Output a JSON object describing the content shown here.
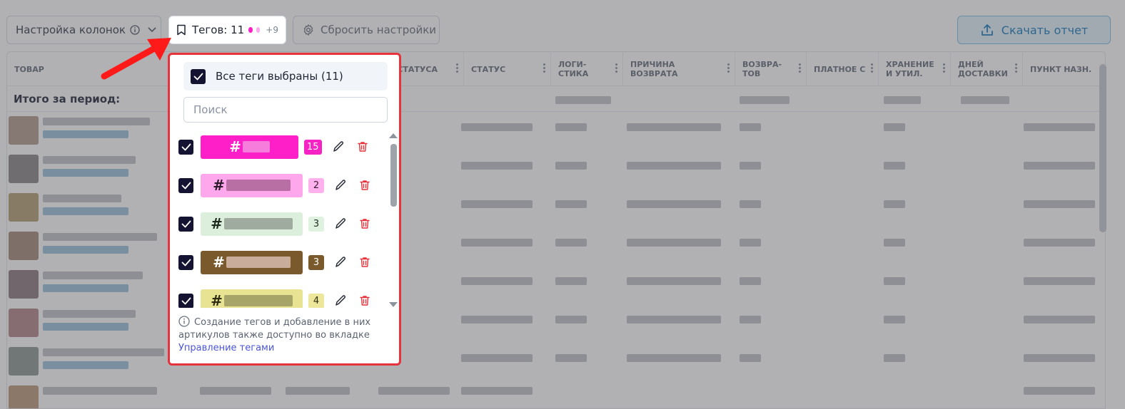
{
  "toolbar": {
    "columns_label": "Настройка колонок",
    "tags_label": "Тегов: 11",
    "tags_more": "+9",
    "reset_label": "Сбросить настройки",
    "download_label": "Скачать отчет"
  },
  "table": {
    "headers": [
      "ТОВАР",
      "А СТАТУСА",
      "СТАТУС",
      "ЛОГИ-\nСТИКА",
      "ПРИЧИНА ВОЗВРАТА",
      "ВОЗВРА-\nТОВ",
      "ПЛАТНОЕ С",
      "ХРАНЕНИЕ\nИ УТИЛ.",
      "ДНЕЙ\nДОСТАВКИ",
      "ПУНКТ НАЗН."
    ],
    "totals_label": "Итого за период:"
  },
  "tags_popup": {
    "all_label": "Все теги выбраны (11)",
    "search_placeholder": "Поиск",
    "tags": [
      {
        "hash": "#",
        "count": "15",
        "color": "#ff1fc8",
        "count_bg": "#f522c4",
        "count_fg": "#ffffff",
        "text": "#ffffff"
      },
      {
        "hash": "#",
        "count": "2",
        "color": "#ffa7ec",
        "count_bg": "#ffb1ee",
        "count_fg": "#3b1a33",
        "text": "#2b1b2a"
      },
      {
        "hash": "#",
        "count": "3",
        "color": "#dcefdc",
        "count_bg": "#dff1df",
        "count_fg": "#243024",
        "text": "#1e2a1e"
      },
      {
        "hash": "#",
        "count": "3",
        "color": "#7a5a2c",
        "count_bg": "#7a5a2c",
        "count_fg": "#ffffff",
        "text": "#ffffff"
      },
      {
        "hash": "#",
        "count": "4",
        "color": "#e8e392",
        "count_bg": "#ece79a",
        "count_fg": "#2d2b10",
        "text": "#2d2b10"
      }
    ],
    "note_text": "Создание тегов и добавление в них артикулов также доступно во вкладке",
    "note_link": "Управление тегами"
  },
  "colors": {
    "accent_red": "#e5323b",
    "checkbox": "#141432",
    "download_accent": "#1f7fbf",
    "link": "#4b55d9"
  }
}
